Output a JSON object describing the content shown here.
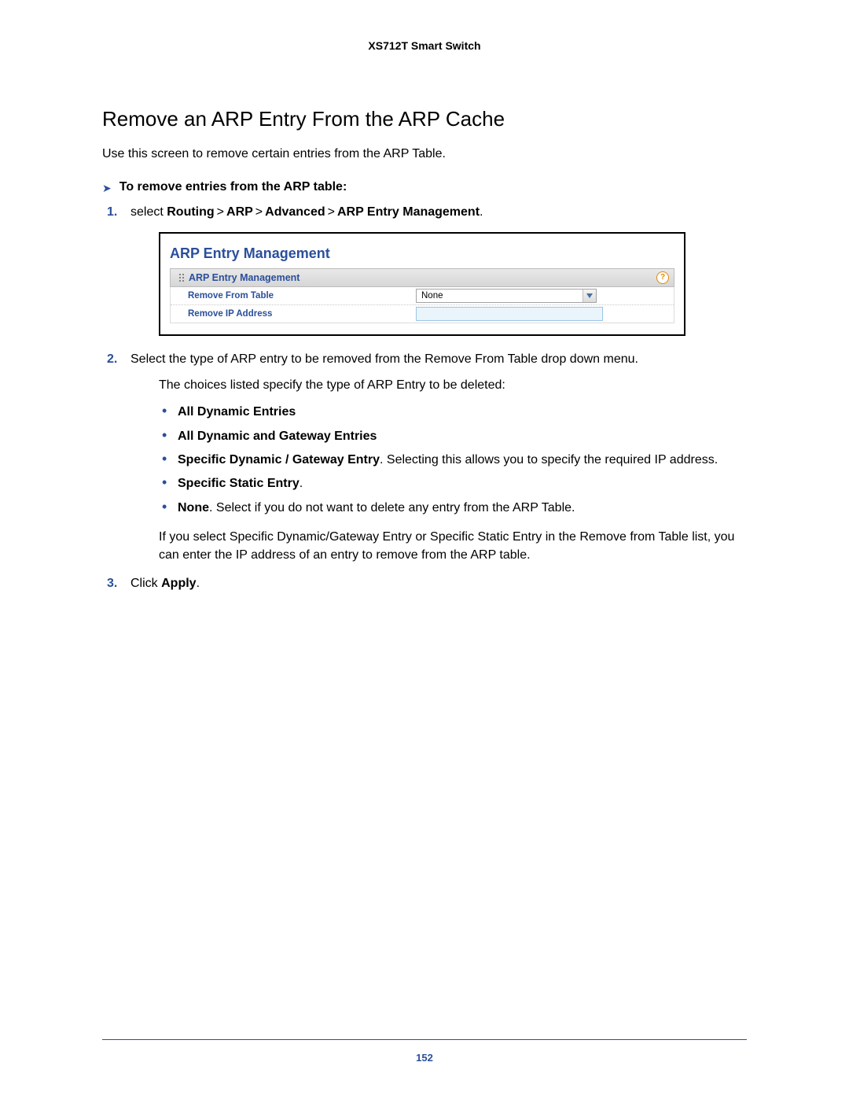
{
  "header": {
    "title": "XS712T Smart Switch"
  },
  "section": {
    "title": "Remove an ARP Entry From the ARP Cache",
    "intro": "Use this screen to remove certain entries from the ARP Table.",
    "procedure_label": "To remove entries from the ARP table:"
  },
  "steps": {
    "s1": {
      "num": "1.",
      "prefix": "select ",
      "nav1": "Routing",
      "nav2": "ARP",
      "nav3": "Advanced",
      "nav4": "ARP Entry Management",
      "gt": ">",
      "dot": "."
    },
    "s2": {
      "num": "2.",
      "text": "Select the type of ARP entry to be removed from the Remove From Table drop down menu.",
      "sub_intro": "The choices listed specify the type of ARP Entry to be deleted:",
      "sub_outro": "If you select Specific Dynamic/Gateway Entry or Specific Static Entry in the Remove from Table list, you can enter the IP address of an entry to remove from the ARP table."
    },
    "s3": {
      "num": "3.",
      "prefix": "Click ",
      "action": "Apply",
      "dot": "."
    }
  },
  "bullets": {
    "b1": "All Dynamic Entries",
    "b2": "All Dynamic and Gateway Entries",
    "b3_label": "Specific Dynamic / Gateway Entry",
    "b3_rest": ". Selecting this allows you to specify the required IP address.",
    "b4_label": "Specific Static Entry",
    "b4_dot": ".",
    "b5_label": "None",
    "b5_rest": ". Select if you do not want to delete any entry from the ARP Table."
  },
  "panel": {
    "big_title": "ARP Entry Management",
    "subhead": "ARP Entry Management",
    "help": "?",
    "row1_label": "Remove From Table",
    "row1_value": "None",
    "row2_label": "Remove IP Address",
    "row2_value": ""
  },
  "footer": {
    "page": "152"
  }
}
